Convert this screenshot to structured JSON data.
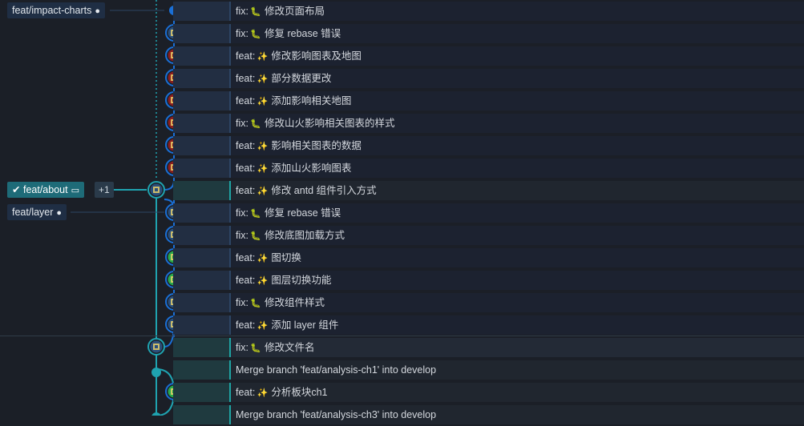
{
  "branches": {
    "impact_charts": {
      "label": "feat/impact-charts",
      "icon": "github-icon"
    },
    "about": {
      "label": "feat/about",
      "icon": "laptop-icon",
      "check_icon": "check-icon",
      "extra": "+1"
    },
    "layer": {
      "label": "feat/layer",
      "icon": "github-icon"
    }
  },
  "commits": [
    {
      "type": "fix:",
      "emoji": "bug",
      "text": "修改页面布局"
    },
    {
      "type": "fix:",
      "emoji": "bug",
      "text": "修复 rebase 错误"
    },
    {
      "type": "feat:",
      "emoji": "sparkle",
      "text": "修改影响图表及地图"
    },
    {
      "type": "feat:",
      "emoji": "sparkle",
      "text": "部分数据更改"
    },
    {
      "type": "feat:",
      "emoji": "sparkle",
      "text": "添加影响相关地图"
    },
    {
      "type": "fix:",
      "emoji": "bug",
      "text": "修改山火影响相关图表的样式"
    },
    {
      "type": "feat:",
      "emoji": "sparkle",
      "text": "影响相关图表的数据"
    },
    {
      "type": "feat:",
      "emoji": "sparkle",
      "text": "添加山火影响图表"
    },
    {
      "type": "feat:",
      "emoji": "sparkle",
      "text": "修改 antd 组件引入方式"
    },
    {
      "type": "fix:",
      "emoji": "bug",
      "text": "修复 rebase 错误"
    },
    {
      "type": "fix:",
      "emoji": "bug",
      "text": "修改底图加载方式"
    },
    {
      "type": "feat:",
      "emoji": "sparkle",
      "text": "图切换"
    },
    {
      "type": "feat:",
      "emoji": "sparkle",
      "text": "图层切换功能"
    },
    {
      "type": "fix:",
      "emoji": "bug",
      "text": "修改组件样式"
    },
    {
      "type": "feat:",
      "emoji": "sparkle",
      "text": "添加 layer 组件"
    },
    {
      "type": "fix:",
      "emoji": "bug",
      "text": "修改文件名"
    },
    {
      "type": "",
      "emoji": "",
      "text": "Merge branch 'feat/analysis-ch1' into develop"
    },
    {
      "type": "feat:",
      "emoji": "sparkle",
      "text": "分析板块ch1"
    },
    {
      "type": "",
      "emoji": "",
      "text": "Merge branch 'feat/analysis-ch3' into develop"
    }
  ],
  "colors": {
    "blue_lane": "#1a6fd6",
    "teal_lane": "#1fa3b0",
    "avatar_red": "#8a1e1e",
    "avatar_green": "#2aa84a",
    "avatar_blue": "#2a4e7a"
  }
}
